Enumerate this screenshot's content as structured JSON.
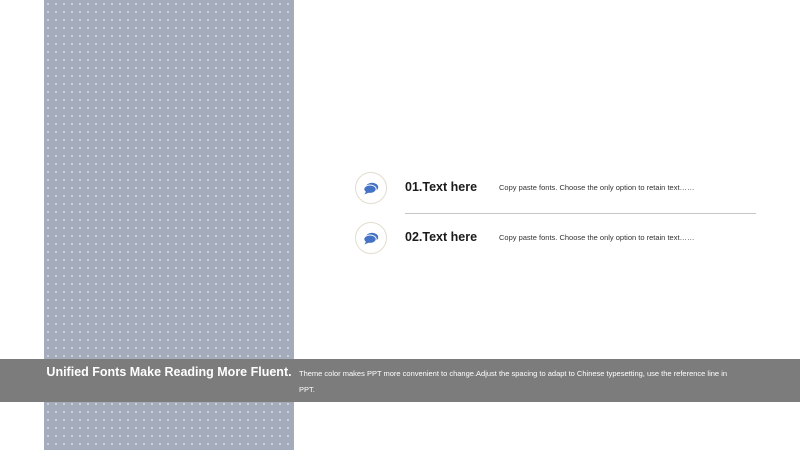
{
  "items": [
    {
      "title": "01.Text here",
      "description": "Copy paste fonts. Choose the only option to retain text……",
      "icon": "speech-bubble-icon"
    },
    {
      "title": "02.Text here",
      "description": "Copy paste fonts. Choose the only option to retain text……",
      "icon": "speech-bubble-icon"
    }
  ],
  "banner": {
    "title": "Unified Fonts Make Reading More Fluent.",
    "text": "Theme color makes PPT more convenient to change.Adjust the spacing to adapt to Chinese typesetting, use the reference line in PPT."
  },
  "colors": {
    "side_panel": "#a4abba",
    "icon_accent": "#4472c4",
    "banner_bg": "#7c7c7c"
  }
}
